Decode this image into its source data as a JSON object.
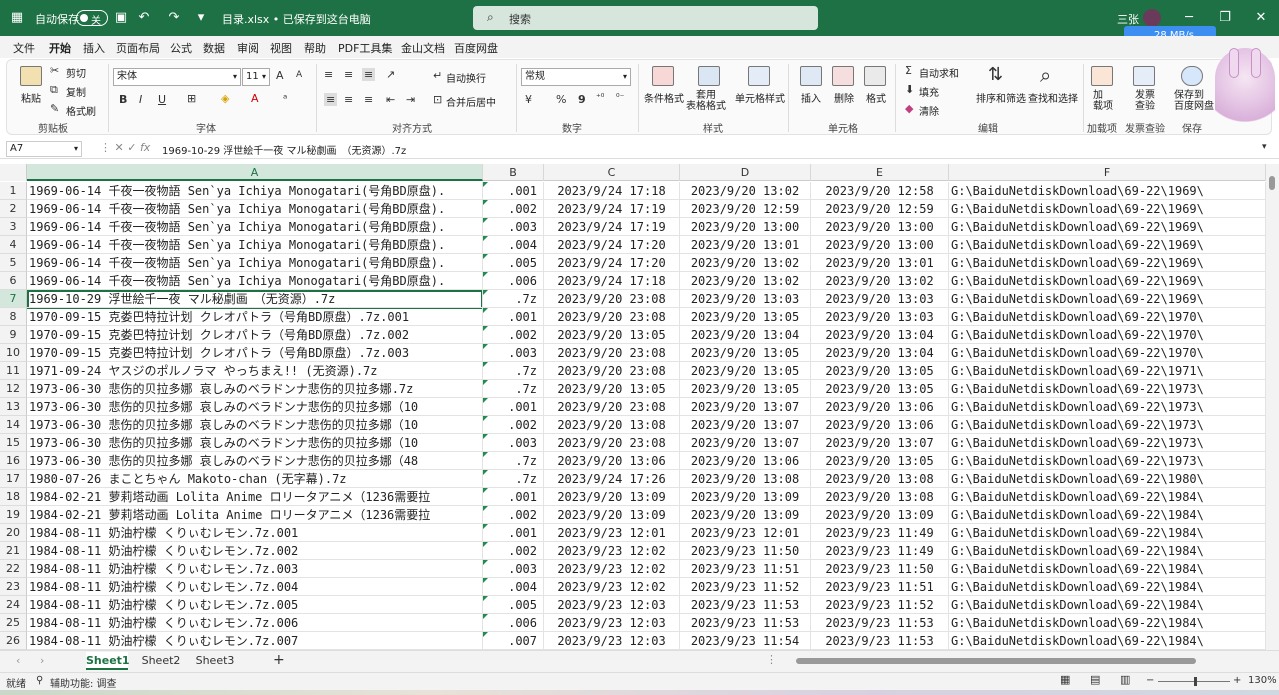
{
  "titlebar": {
    "autosave": "自动保存",
    "toggle": "关",
    "doc_title": "目录.xlsx • 已保存到这台电脑",
    "search_placeholder": "搜索",
    "user": "三张",
    "speed": "28 MB/s"
  },
  "menu": {
    "items": [
      "文件",
      "开始",
      "插入",
      "页面布局",
      "公式",
      "数据",
      "审阅",
      "视图",
      "帮助",
      "PDF工具集",
      "金山文档",
      "百度网盘"
    ],
    "active": "开始",
    "comment_btn": "批注",
    "share_btn": "共享"
  },
  "ribbon": {
    "groups": [
      "剪贴板",
      "字体",
      "对齐方式",
      "数字",
      "样式",
      "单元格",
      "编辑",
      "加载项",
      "发票查验",
      "保存"
    ],
    "clipboard": {
      "paste": "粘贴",
      "cut": "剪切",
      "copy": "复制",
      "format_painter": "格式刷"
    },
    "font": {
      "name": "宋体",
      "size": "11",
      "bold": "B",
      "italic": "I",
      "underline": "U",
      "grow": "A",
      "shrink": "A"
    },
    "alignment": {
      "wrap": "自动换行",
      "merge": "合并后居中"
    },
    "number": {
      "format": "常规",
      "percent": "%",
      "comma": "9"
    },
    "styles": {
      "conditional": "条件格式",
      "table": "套用\n表格格式",
      "cell_styles": "单元格样式"
    },
    "cells": {
      "insert": "插入",
      "delete": "删除",
      "format": "格式"
    },
    "editing": {
      "autosum": "自动求和",
      "fill": "填充",
      "clear": "清除",
      "sort": "排序和筛选",
      "find": "查找和选择"
    },
    "addins": {
      "addin": "加\n载项",
      "invoice": "发票\n查验",
      "save_baidu": "保存到\n百度网盘"
    }
  },
  "formula_bar": {
    "name_box": "A7",
    "fx": "fx",
    "content": "1969-10-29 浮世絵千一夜 マル秘劇画　（无资源）.7z"
  },
  "columns": [
    "A",
    "B",
    "C",
    "D",
    "E",
    "F"
  ],
  "selected_cell": {
    "row": 7,
    "col": "A"
  },
  "rows": [
    [
      "1",
      "1969-06-14 千夜一夜物語 Sen`ya Ichiya Monogatari(号角BD原盘).",
      ".001",
      "2023/9/24 17:18",
      "2023/9/20 13:02",
      "2023/9/20 12:58",
      "G:\\BaiduNetdiskDownload\\69-22\\1969\\"
    ],
    [
      "2",
      "1969-06-14 千夜一夜物語 Sen`ya Ichiya Monogatari(号角BD原盘).",
      ".002",
      "2023/9/24 17:19",
      "2023/9/20 12:59",
      "2023/9/20 12:59",
      "G:\\BaiduNetdiskDownload\\69-22\\1969\\"
    ],
    [
      "3",
      "1969-06-14 千夜一夜物語 Sen`ya Ichiya Monogatari(号角BD原盘).",
      ".003",
      "2023/9/24 17:19",
      "2023/9/20 13:00",
      "2023/9/20 13:00",
      "G:\\BaiduNetdiskDownload\\69-22\\1969\\"
    ],
    [
      "4",
      "1969-06-14 千夜一夜物語 Sen`ya Ichiya Monogatari(号角BD原盘).",
      ".004",
      "2023/9/24 17:20",
      "2023/9/20 13:01",
      "2023/9/20 13:00",
      "G:\\BaiduNetdiskDownload\\69-22\\1969\\"
    ],
    [
      "5",
      "1969-06-14 千夜一夜物語 Sen`ya Ichiya Monogatari(号角BD原盘).",
      ".005",
      "2023/9/24 17:20",
      "2023/9/20 13:02",
      "2023/9/20 13:01",
      "G:\\BaiduNetdiskDownload\\69-22\\1969\\"
    ],
    [
      "6",
      "1969-06-14 千夜一夜物語 Sen`ya Ichiya Monogatari(号角BD原盘).",
      ".006",
      "2023/9/24 17:18",
      "2023/9/20 13:02",
      "2023/9/20 13:02",
      "G:\\BaiduNetdiskDownload\\69-22\\1969\\"
    ],
    [
      "7",
      "1969-10-29 浮世絵千一夜 マル秘劇画　（无资源）.7z",
      ".7z",
      "2023/9/20 23:08",
      "2023/9/20 13:03",
      "2023/9/20 13:03",
      "G:\\BaiduNetdiskDownload\\69-22\\1969\\"
    ],
    [
      "8",
      "1970-09-15 克娄巴特拉计划 クレオパトラ（号角BD原盘）.7z.001",
      ".001",
      "2023/9/20 23:08",
      "2023/9/20 13:05",
      "2023/9/20 13:03",
      "G:\\BaiduNetdiskDownload\\69-22\\1970\\"
    ],
    [
      "9",
      "1970-09-15 克娄巴特拉计划 クレオパトラ（号角BD原盘）.7z.002",
      ".002",
      "2023/9/20 13:05",
      "2023/9/20 13:04",
      "2023/9/20 13:04",
      "G:\\BaiduNetdiskDownload\\69-22\\1970\\"
    ],
    [
      "10",
      "1970-09-15 克娄巴特拉计划 クレオパトラ（号角BD原盘）.7z.003",
      ".003",
      "2023/9/20 23:08",
      "2023/9/20 13:05",
      "2023/9/20 13:04",
      "G:\\BaiduNetdiskDownload\\69-22\\1970\\"
    ],
    [
      "11",
      "1971-09-24 ヤスジのポルノラマ やっちまえ!! (无资源).7z",
      ".7z",
      "2023/9/20 23:08",
      "2023/9/20 13:05",
      "2023/9/20 13:05",
      "G:\\BaiduNetdiskDownload\\69-22\\1971\\"
    ],
    [
      "12",
      "1973-06-30 悲伤的贝拉多娜 哀しみのベラドンナ悲伤的贝拉多娜.7z",
      ".7z",
      "2023/9/20 13:05",
      "2023/9/20 13:05",
      "2023/9/20 13:05",
      "G:\\BaiduNetdiskDownload\\69-22\\1973\\"
    ],
    [
      "13",
      "1973-06-30 悲伤的贝拉多娜 哀しみのベラドンナ悲伤的贝拉多娜（10",
      ".001",
      "2023/9/20 23:08",
      "2023/9/20 13:07",
      "2023/9/20 13:06",
      "G:\\BaiduNetdiskDownload\\69-22\\1973\\"
    ],
    [
      "14",
      "1973-06-30 悲伤的贝拉多娜 哀しみのベラドンナ悲伤的贝拉多娜（10",
      ".002",
      "2023/9/20 13:08",
      "2023/9/20 13:07",
      "2023/9/20 13:06",
      "G:\\BaiduNetdiskDownload\\69-22\\1973\\"
    ],
    [
      "15",
      "1973-06-30 悲伤的贝拉多娜 哀しみのベラドンナ悲伤的贝拉多娜（10",
      ".003",
      "2023/9/20 23:08",
      "2023/9/20 13:07",
      "2023/9/20 13:07",
      "G:\\BaiduNetdiskDownload\\69-22\\1973\\"
    ],
    [
      "16",
      "1973-06-30 悲伤的贝拉多娜 哀しみのベラドンナ悲伤的贝拉多娜（48",
      ".7z",
      "2023/9/20 13:06",
      "2023/9/20 13:06",
      "2023/9/20 13:05",
      "G:\\BaiduNetdiskDownload\\69-22\\1973\\"
    ],
    [
      "17",
      "1980-07-26 まことちゃん Makoto-chan (无字幕).7z",
      ".7z",
      "2023/9/24 17:26",
      "2023/9/20 13:08",
      "2023/9/20 13:08",
      "G:\\BaiduNetdiskDownload\\69-22\\1980\\"
    ],
    [
      "18",
      "1984-02-21 萝莉塔动画 Lolita Anime ロリータアニメ（1236需要拉",
      ".001",
      "2023/9/20 13:09",
      "2023/9/20 13:09",
      "2023/9/20 13:08",
      "G:\\BaiduNetdiskDownload\\69-22\\1984\\"
    ],
    [
      "19",
      "1984-02-21 萝莉塔动画 Lolita Anime ロリータアニメ（1236需要拉",
      ".002",
      "2023/9/20 13:09",
      "2023/9/20 13:09",
      "2023/9/20 13:09",
      "G:\\BaiduNetdiskDownload\\69-22\\1984\\"
    ],
    [
      "20",
      "1984-08-11 奶油柠檬 くりぃむレモン.7z.001",
      ".001",
      "2023/9/23 12:01",
      "2023/9/23 12:01",
      "2023/9/23 11:49",
      "G:\\BaiduNetdiskDownload\\69-22\\1984\\"
    ],
    [
      "21",
      "1984-08-11 奶油柠檬 くりぃむレモン.7z.002",
      ".002",
      "2023/9/23 12:02",
      "2023/9/23 11:50",
      "2023/9/23 11:49",
      "G:\\BaiduNetdiskDownload\\69-22\\1984\\"
    ],
    [
      "22",
      "1984-08-11 奶油柠檬 くりぃむレモン.7z.003",
      ".003",
      "2023/9/23 12:02",
      "2023/9/23 11:51",
      "2023/9/23 11:50",
      "G:\\BaiduNetdiskDownload\\69-22\\1984\\"
    ],
    [
      "23",
      "1984-08-11 奶油柠檬 くりぃむレモン.7z.004",
      ".004",
      "2023/9/23 12:02",
      "2023/9/23 11:52",
      "2023/9/23 11:51",
      "G:\\BaiduNetdiskDownload\\69-22\\1984\\"
    ],
    [
      "24",
      "1984-08-11 奶油柠檬 くりぃむレモン.7z.005",
      ".005",
      "2023/9/23 12:03",
      "2023/9/23 11:53",
      "2023/9/23 11:52",
      "G:\\BaiduNetdiskDownload\\69-22\\1984\\"
    ],
    [
      "25",
      "1984-08-11 奶油柠檬 くりぃむレモン.7z.006",
      ".006",
      "2023/9/23 12:03",
      "2023/9/23 11:53",
      "2023/9/23 11:53",
      "G:\\BaiduNetdiskDownload\\69-22\\1984\\"
    ],
    [
      "26",
      "1984-08-11 奶油柠檬 くりぃむレモン.7z.007",
      ".007",
      "2023/9/23 12:03",
      "2023/9/23 11:54",
      "2023/9/23 11:53",
      "G:\\BaiduNetdiskDownload\\69-22\\1984\\"
    ]
  ],
  "sheets": [
    "Sheet1",
    "Sheet2",
    "Sheet3"
  ],
  "active_sheet": "Sheet1",
  "status": {
    "ready": "就绪",
    "accessibility": "辅助功能: 调查",
    "zoom": "130%"
  },
  "colors": {
    "accent": "#1e7145",
    "selection": "#d4e7dc"
  }
}
